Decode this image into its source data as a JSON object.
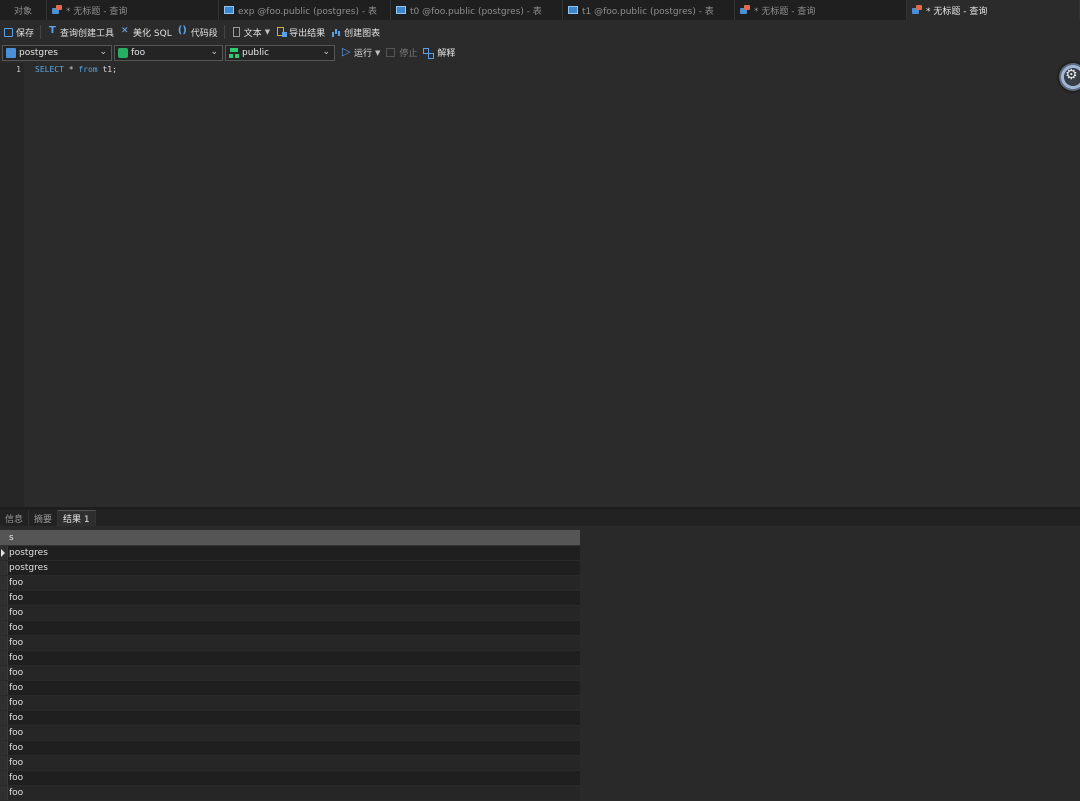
{
  "tabs": [
    {
      "label": "对象",
      "icon": "",
      "active": false
    },
    {
      "label": "* 无标题 - 查询",
      "icon": "query-icon",
      "active": false
    },
    {
      "label": "exp @foo.public (postgres) - 表",
      "icon": "table-icon",
      "active": false
    },
    {
      "label": "t0 @foo.public (postgres) - 表",
      "icon": "table-icon",
      "active": false
    },
    {
      "label": "t1 @foo.public (postgres) - 表",
      "icon": "table-icon",
      "active": false
    },
    {
      "label": "* 无标题 - 查询",
      "icon": "query-icon",
      "active": false
    },
    {
      "label": "* 无标题 - 查询",
      "icon": "query-icon",
      "active": true
    }
  ],
  "toolbar": {
    "save": "保存",
    "query_builder": "查询创建工具",
    "beautify_sql": "美化 SQL",
    "code_snippet": "代码段",
    "text": "文本",
    "export_result": "导出结果",
    "create_chart": "创建图表"
  },
  "connection_bar": {
    "connection": "postgres",
    "database": "foo",
    "schema": "public",
    "run": "运行",
    "stop": "停止",
    "explain": "解释"
  },
  "editor": {
    "line_number": "1",
    "keyword_select": "SELECT",
    "rest_1": " * ",
    "keyword_from": "from",
    "rest_2": " t1;"
  },
  "result_tabs": [
    "信息",
    "摘要",
    "结果 1"
  ],
  "result_grid": {
    "column": "s",
    "rows": [
      "postgres",
      "postgres",
      "foo",
      "foo",
      "foo",
      "foo",
      "foo",
      "foo",
      "foo",
      "foo",
      "foo",
      "foo",
      "foo",
      "foo",
      "foo",
      "foo",
      "foo"
    ]
  },
  "colors": {
    "accent": "#5aa7e8",
    "background": "#2b2b2b"
  }
}
